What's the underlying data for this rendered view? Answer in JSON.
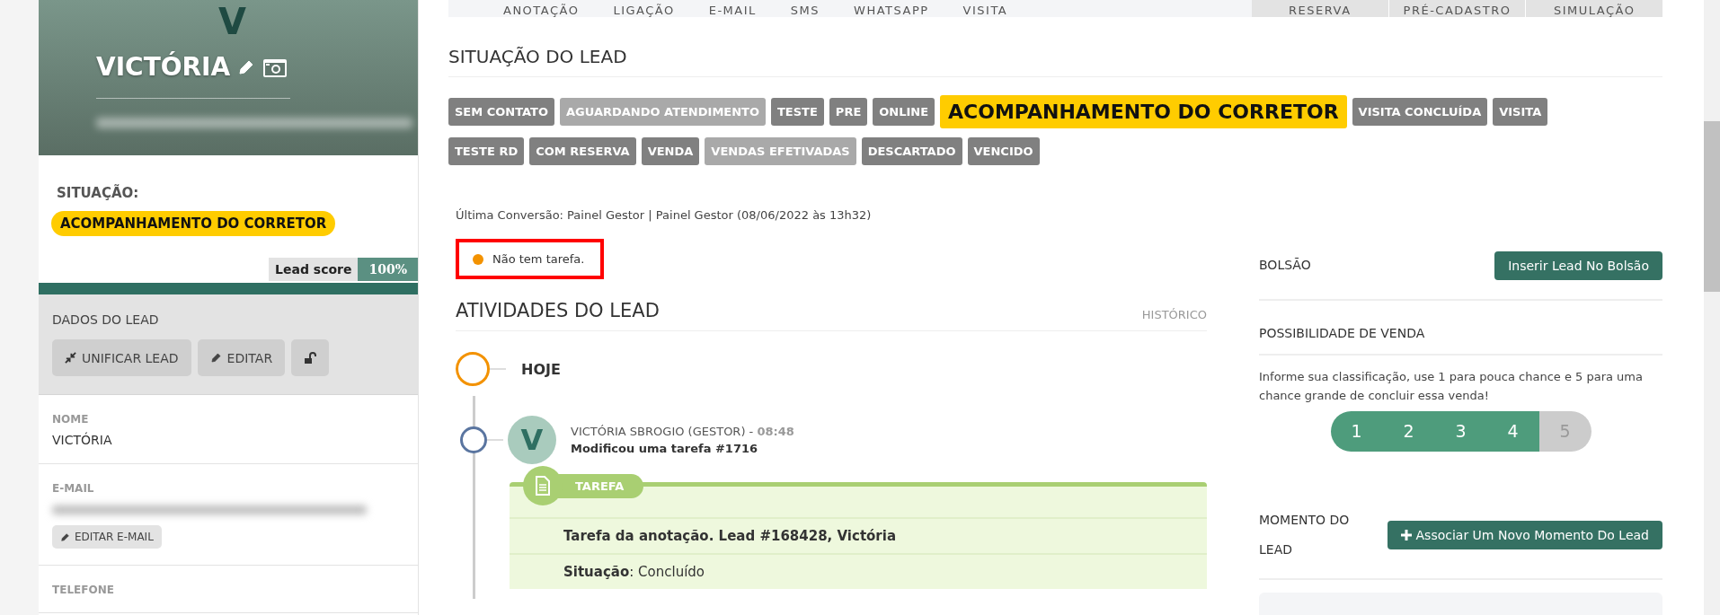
{
  "profile": {
    "monogram": "V",
    "name": "VICTÓRIA",
    "status_label": "SITUAÇÃO:",
    "status": "ACOMPANHAMENTO DO CORRETOR",
    "lead_score": {
      "label": "Lead score",
      "value": "100%",
      "level": 1
    }
  },
  "lead_data": {
    "title": "DADOS DO LEAD",
    "buttons": [
      {
        "kind": "merge",
        "label": "UNIFICAR LEAD"
      },
      {
        "kind": "edit",
        "label": "EDITAR"
      },
      {
        "kind": "lock"
      }
    ],
    "fields": [
      {
        "label": "NOME",
        "value": "VICTÓRIA"
      },
      {
        "label": "E-MAIL",
        "button": "EDITAR E-MAIL"
      },
      {
        "label": "TELEFONE"
      }
    ]
  },
  "action_tabs": [
    "ANOTAÇÃO",
    "LIGAÇÃO",
    "E-MAIL",
    "SMS",
    "WHATSAPP",
    "VISITA"
  ],
  "side_tabs": [
    "RESERVA",
    "PRÉ-CADASTRO",
    "SIMULAÇÃO"
  ],
  "status_title": "SITUAÇÃO DO LEAD",
  "statuses": [
    {
      "label": "SEM CONTATO",
      "selected": false,
      "disabled": false
    },
    {
      "label": "AGUARDANDO ATENDIMENTO",
      "selected": false,
      "disabled": true
    },
    {
      "label": "TESTE",
      "selected": false,
      "disabled": false
    },
    {
      "label": "PRE",
      "selected": false,
      "disabled": false
    },
    {
      "label": "ONLINE",
      "selected": false,
      "disabled": false
    },
    {
      "label": "ACOMPANHAMENTO DO CORRETOR",
      "selected": true,
      "disabled": false
    },
    {
      "label": "VISITA CONCLUÍDA",
      "selected": false,
      "disabled": false
    },
    {
      "label": "VISITA",
      "selected": false,
      "disabled": false
    },
    {
      "label": "TESTE RD",
      "selected": false,
      "disabled": false
    },
    {
      "label": "COM RESERVA",
      "selected": false,
      "disabled": false
    },
    {
      "label": "VENDA",
      "selected": false,
      "disabled": false
    },
    {
      "label": "VENDAS EFETIVADAS",
      "selected": false,
      "disabled": true
    },
    {
      "label": "DESCARTADO",
      "selected": false,
      "disabled": false
    },
    {
      "label": "VENCIDO",
      "selected": false,
      "disabled": false
    }
  ],
  "last_conversion": "Última Conversão: Painel Gestor | Painel Gestor (08/06/2022 às 13h32)",
  "task_notice": {
    "text": "Não tem tarefa.",
    "color": "#f39200"
  },
  "activities": {
    "title": "ATIVIDADES DO LEAD",
    "history_link": "HISTÓRICO",
    "day": "HOJE",
    "entry": {
      "avatar": "V",
      "author": "VICTÓRIA SBROGIO (GESTOR) - ",
      "time": "08:48",
      "action": "Modificou uma tarefa #1716",
      "card": {
        "tag": "TAREFA",
        "title": "Tarefa da anotação. Lead #168428, Victória",
        "status": "**Situação**: Concluído"
      }
    }
  },
  "bolsao": {
    "title": "BOLSÃO",
    "button": "Inserir Lead No Bolsão"
  },
  "sale_possibility": {
    "title": "POSSIBILIDADE DE VENDA",
    "hint": "Informe sua classificação, use 1 para pouca chance e 5 para uma chance grande de concluir essa venda!",
    "options": [
      {
        "label": "1",
        "selected": true
      },
      {
        "label": "2",
        "selected": true
      },
      {
        "label": "3",
        "selected": true
      },
      {
        "label": "4",
        "selected": true
      },
      {
        "label": "5",
        "selected": false
      }
    ]
  },
  "moment": {
    "title": "MOMENTO DO LEAD",
    "button": "Associar Um Novo Momento Do Lead"
  }
}
